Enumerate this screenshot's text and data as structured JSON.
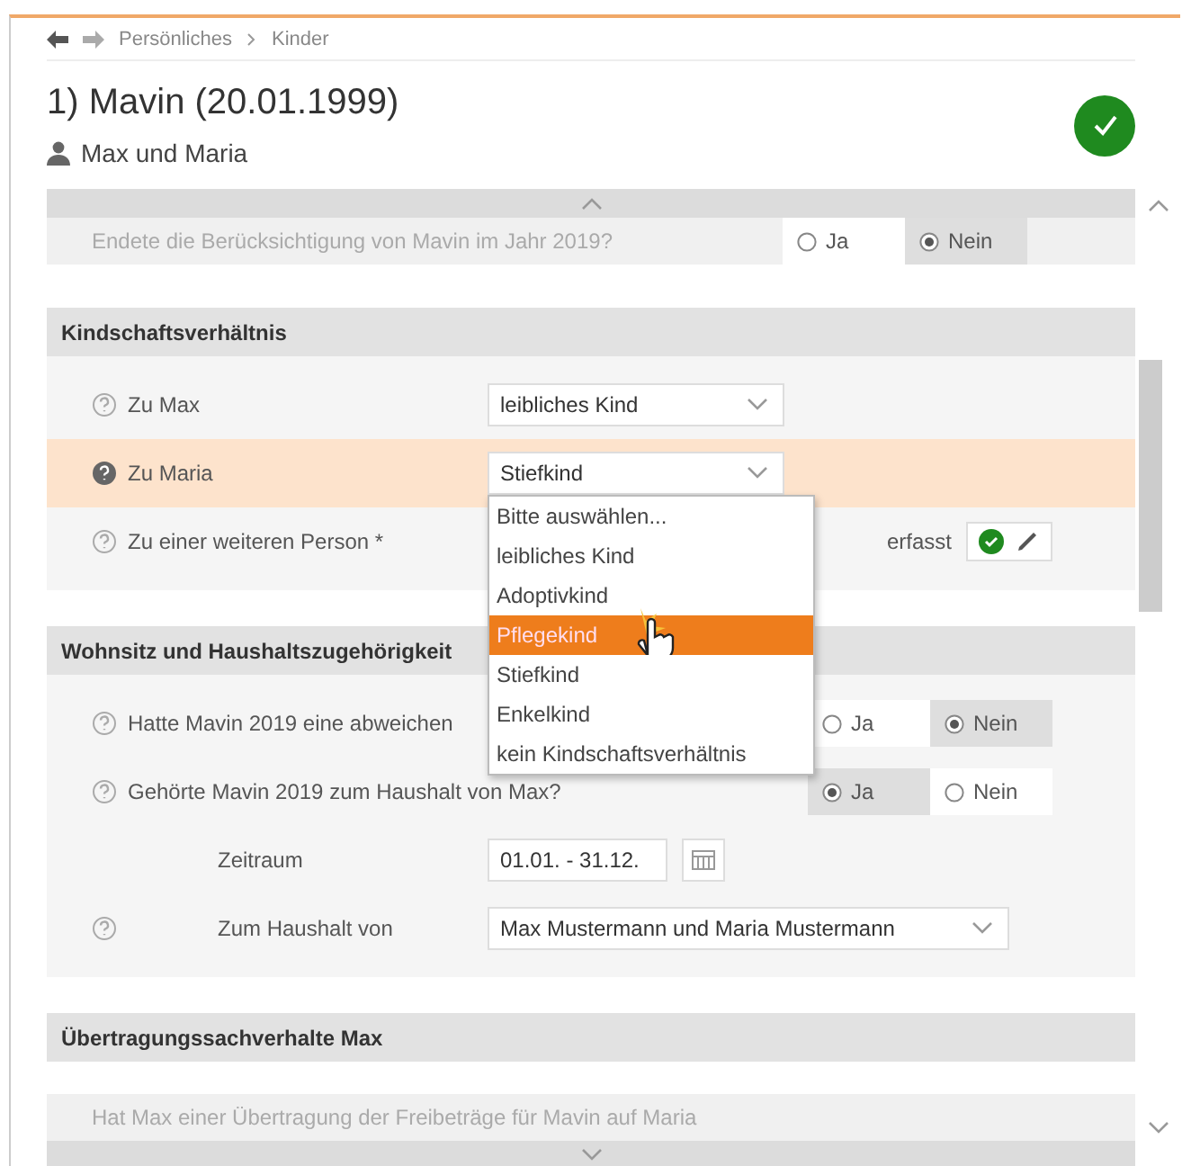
{
  "breadcrumb": [
    "Persönliches",
    "Kinder"
  ],
  "header": {
    "title": "1) Mavin (20.01.1999)",
    "subtitle": "Max und Maria",
    "complete": true
  },
  "faded_top": {
    "question": "Endete die Berücksichtigung von Mavin im Jahr 2019?",
    "options": [
      {
        "label": "Ja",
        "selected": false
      },
      {
        "label": "Nein",
        "selected": true
      }
    ]
  },
  "sections": [
    {
      "title": "Kindschaftsverhältnis",
      "rows": [
        {
          "kind": "select",
          "label": "Zu Max",
          "value": "leibliches Kind",
          "highlighted": false,
          "help": true,
          "sub": false
        },
        {
          "kind": "select",
          "label": "Zu Maria",
          "value": "Stiefkind",
          "highlighted": true,
          "help": true,
          "sub": false,
          "open": true
        },
        {
          "kind": "status",
          "label": "Zu einer weiteren Person",
          "required_mark": "*",
          "status": "erfasst",
          "done": true,
          "highlighted": false,
          "help": true,
          "sub": false
        }
      ]
    },
    {
      "title": "Wohnsitz und Haushaltszugehörigkeit",
      "rows": [
        {
          "kind": "radio",
          "label": "Hatte Mavin 2019 eine abweichen",
          "highlighted": false,
          "help": true,
          "sub": false,
          "options": [
            {
              "label": "Ja",
              "selected": false
            },
            {
              "label": "Nein",
              "selected": true
            }
          ]
        },
        {
          "kind": "radio",
          "label": "Gehörte Mavin 2019 zum Haushalt von Max?",
          "highlighted": false,
          "help": true,
          "sub": false,
          "options": [
            {
              "label": "Ja",
              "selected": true
            },
            {
              "label": "Nein",
              "selected": false
            }
          ]
        },
        {
          "kind": "date",
          "label": "Zeitraum",
          "value": "01.01. - 31.12.",
          "highlighted": false,
          "help": false,
          "sub": true
        },
        {
          "kind": "select",
          "label": "Zum Haushalt von",
          "value": "Max Mustermann und Maria Mustermann",
          "highlighted": false,
          "help": true,
          "sub": true,
          "wide": true
        }
      ]
    },
    {
      "title": "Übertragungssachverhalte Max"
    }
  ],
  "dropdown": [
    {
      "label": "Bitte auswählen...",
      "selected": false
    },
    {
      "label": "leibliches Kind",
      "selected": false
    },
    {
      "label": "Adoptivkind",
      "selected": false
    },
    {
      "label": "Pflegekind",
      "selected": true
    },
    {
      "label": "Stiefkind",
      "selected": false
    },
    {
      "label": "Enkelkind",
      "selected": false
    },
    {
      "label": "kein Kindschaftsverhältnis",
      "selected": false
    }
  ],
  "faded_bottom": {
    "question": "Hat Max einer Übertragung der Freibeträge für Mavin auf Maria"
  }
}
